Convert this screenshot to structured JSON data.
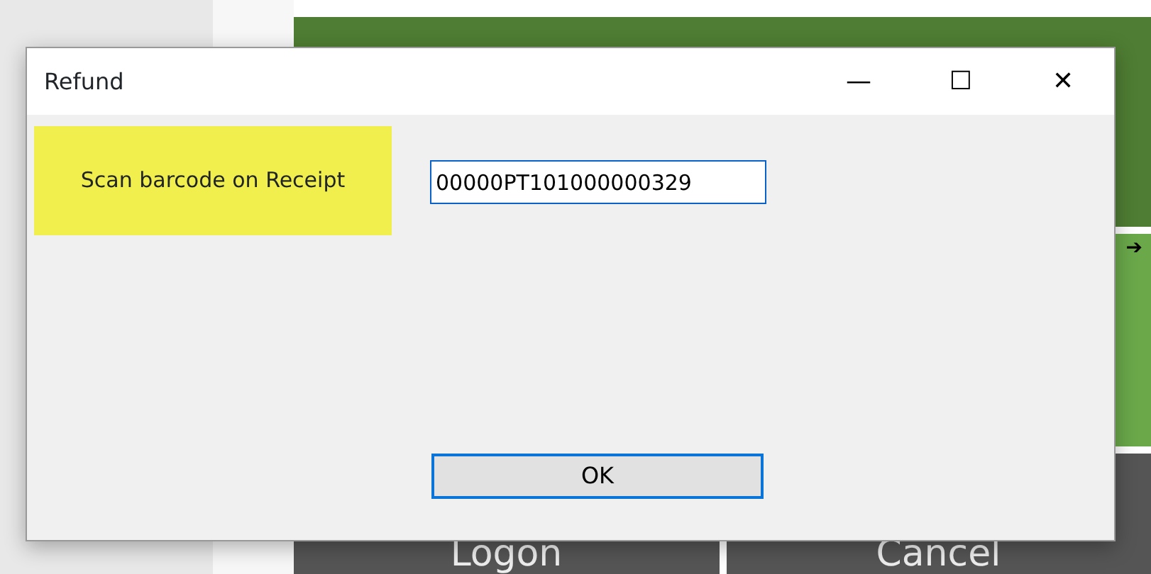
{
  "background": {
    "arrow": "➔",
    "buttons": [
      {
        "label": "Logon"
      },
      {
        "label": "Cancel"
      }
    ]
  },
  "window": {
    "title": "Refund",
    "controls": [
      "—",
      "☐",
      "✕"
    ]
  },
  "prompt": "Scan barcode on Receipt",
  "barcode_field": {
    "value": "00000PT101000000329"
  },
  "buttons": [
    "OK"
  ]
}
